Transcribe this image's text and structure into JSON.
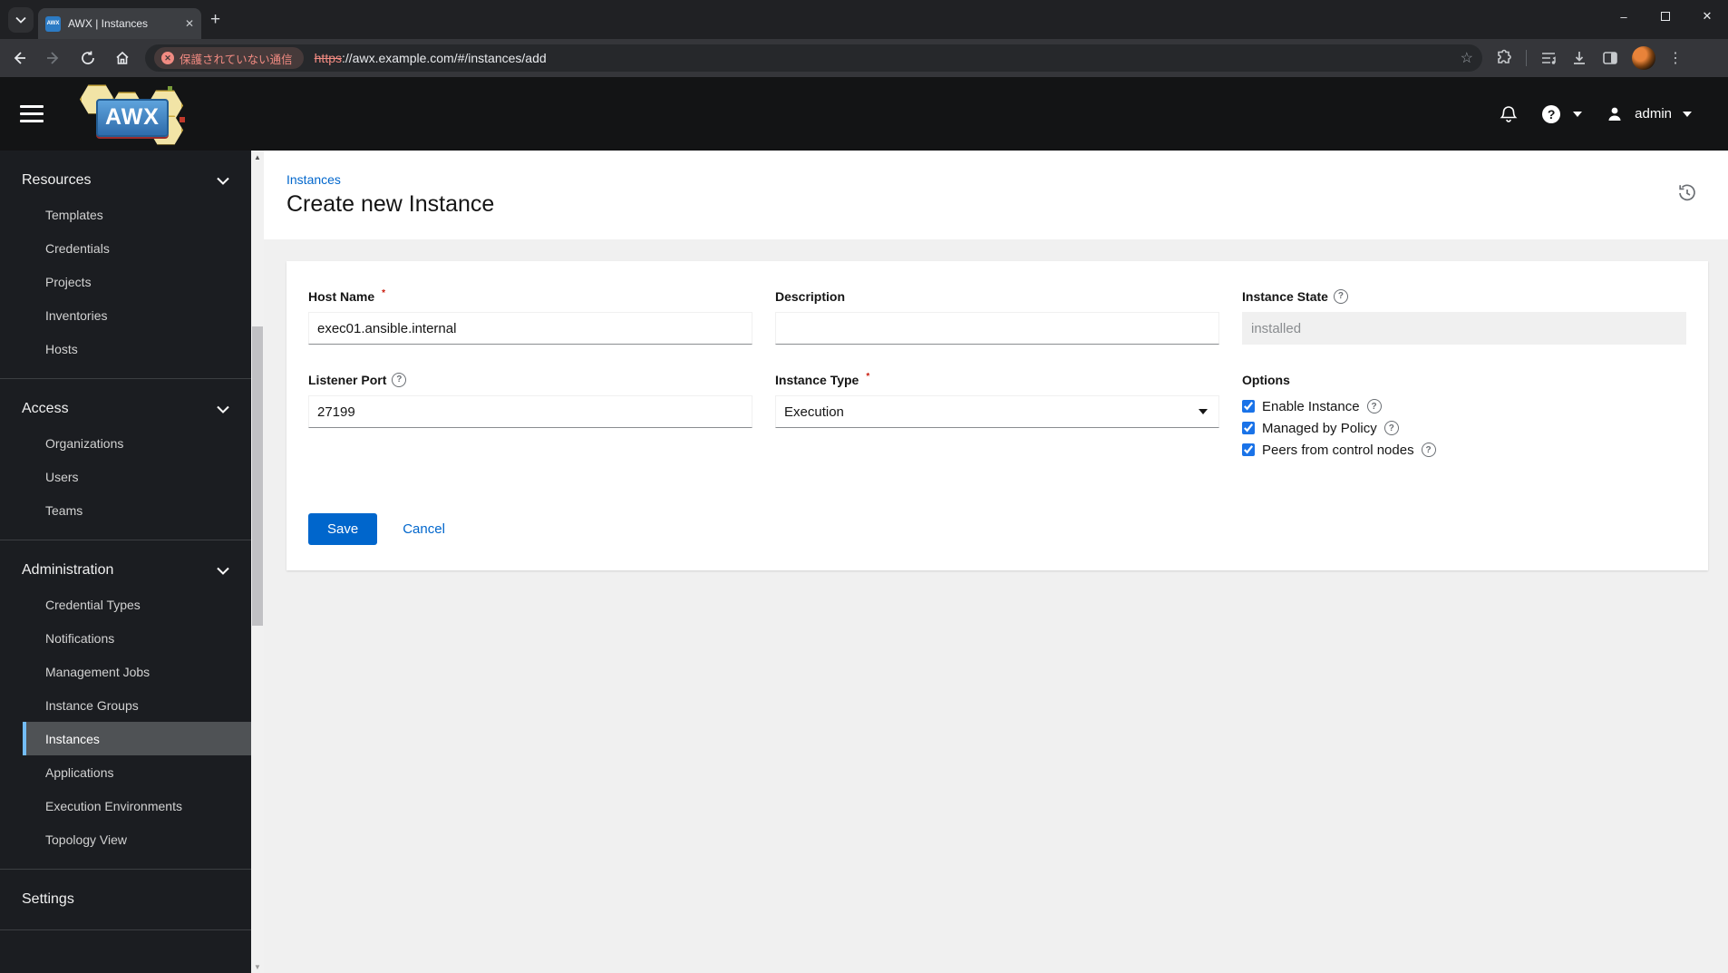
{
  "browser": {
    "tab": {
      "title": "AWX | Instances",
      "favicon_text": "AWX",
      "close_glyph": "✕"
    },
    "new_tab_glyph": "+",
    "url": {
      "security_chip": "保護されていない通信",
      "chip_x": "✕",
      "scheme": "https",
      "rest": "://awx.example.com/#/instances/add"
    },
    "window": {
      "minimize": "–",
      "close": "✕"
    },
    "star_glyph": "☆",
    "kebab_glyph": "⋮"
  },
  "masthead": {
    "logo_text": "AWX",
    "help_glyph": "?",
    "user": "admin"
  },
  "sidebar": {
    "groups": [
      {
        "label": "Resources",
        "items": [
          "Templates",
          "Credentials",
          "Projects",
          "Inventories",
          "Hosts"
        ]
      },
      {
        "label": "Access",
        "items": [
          "Organizations",
          "Users",
          "Teams"
        ]
      },
      {
        "label": "Administration",
        "items": [
          "Credential Types",
          "Notifications",
          "Management Jobs",
          "Instance Groups",
          "Instances",
          "Applications",
          "Execution Environments",
          "Topology View"
        ],
        "selected_item": "Instances"
      },
      {
        "label": "Settings",
        "items": []
      }
    ],
    "scroll_up_glyph": "▲",
    "scroll_down_glyph": "▼"
  },
  "page": {
    "breadcrumb": "Instances",
    "title": "Create new Instance",
    "form": {
      "host_name": {
        "label": "Host Name",
        "required": "*",
        "value": "exec01.ansible.internal"
      },
      "description": {
        "label": "Description",
        "value": ""
      },
      "instance_state": {
        "label": "Instance State",
        "value": "installed",
        "disabled": true,
        "help_glyph": "?"
      },
      "listener_port": {
        "label": "Listener Port",
        "value": "27199",
        "help_glyph": "?"
      },
      "instance_type": {
        "label": "Instance Type",
        "required": "*",
        "value": "Execution"
      },
      "options": {
        "label": "Options",
        "items": [
          {
            "label": "Enable Instance",
            "checked": true
          },
          {
            "label": "Managed by Policy",
            "checked": true
          },
          {
            "label": "Peers from control nodes",
            "checked": true
          }
        ]
      },
      "save_label": "Save",
      "cancel_label": "Cancel"
    }
  },
  "colors": {
    "accent": "#0066cc",
    "nav_selected_border": "#73bcf7",
    "danger": "#c9190b",
    "checkbox": "#1a73e8",
    "chip_text": "#f28b82",
    "masthead_bg": "#131415",
    "sidebar_bg": "#1b1d21"
  }
}
